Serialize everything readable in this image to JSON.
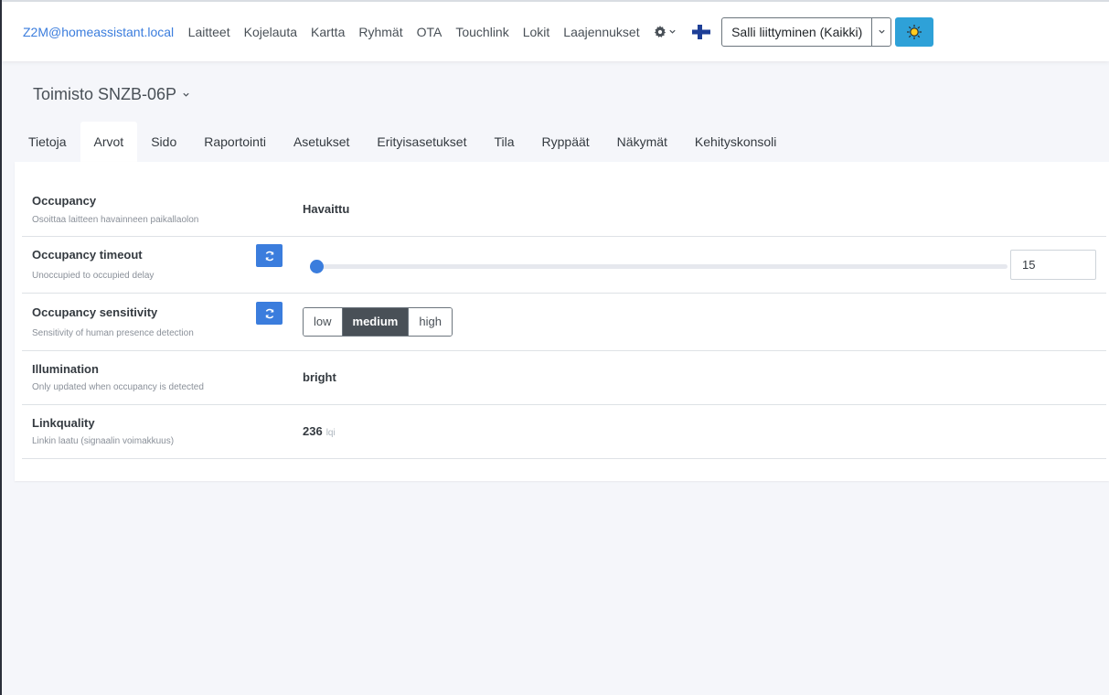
{
  "navbar": {
    "brand": "Z2M@homeassistant.local",
    "links": [
      "Laitteet",
      "Kojelauta",
      "Kartta",
      "Ryhmät",
      "OTA",
      "Touchlink",
      "Lokit",
      "Laajennukset"
    ],
    "settings_icon": "gear-icon",
    "language_icon": "finnish-flag-icon",
    "permit_join_label": "Salli liittyminen (Kaikki)",
    "theme_icon": "sun-icon",
    "theme_color": "#2ea1d8",
    "flag_color": "#1e3f97"
  },
  "device": {
    "title": "Toimisto SNZB-06P"
  },
  "tabs": [
    "Tietoja",
    "Arvot",
    "Sido",
    "Raportointi",
    "Asetukset",
    "Erityisasetukset",
    "Tila",
    "Ryppäät",
    "Näkymät",
    "Kehityskonsoli"
  ],
  "active_tab": "Arvot",
  "accent_color": "#3b7ddd",
  "exposes": {
    "occupancy": {
      "name": "Occupancy",
      "description": "Osoittaa laitteen havainneen paikallaolon",
      "value": "Havaittu"
    },
    "occupancy_timeout": {
      "name": "Occupancy timeout",
      "description": "Unoccupied to occupied delay",
      "value": "15",
      "slider_fraction": 0.0
    },
    "occupancy_sensitivity": {
      "name": "Occupancy sensitivity",
      "description": "Sensitivity of human presence detection",
      "options": [
        "low",
        "medium",
        "high"
      ],
      "selected": "medium"
    },
    "illumination": {
      "name": "Illumination",
      "description": "Only updated when occupancy is detected",
      "value": "bright"
    },
    "linkquality": {
      "name": "Linkquality",
      "description": "Linkin laatu (signaalin voimakkuus)",
      "value": "236",
      "unit": "lqi"
    }
  }
}
